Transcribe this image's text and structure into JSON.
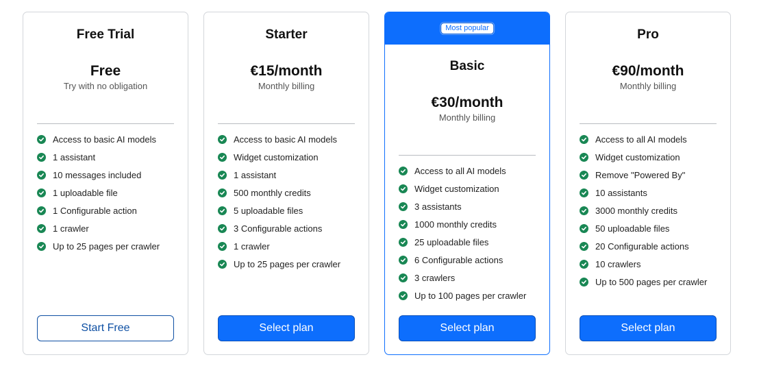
{
  "plans": [
    {
      "name": "Free Trial",
      "price": "Free",
      "billing": "Try with no obligation",
      "features": [
        "Access to basic AI models",
        "1 assistant",
        "10 messages included",
        "1 uploadable file",
        "1 Configurable action",
        "1 crawler",
        "Up to 25 pages per crawler"
      ],
      "button": "Start Free"
    },
    {
      "name": "Starter",
      "price": "€15/month",
      "billing": "Monthly billing",
      "features": [
        "Access to basic AI models",
        "Widget customization",
        "1 assistant",
        "500 monthly credits",
        "5 uploadable files",
        "3 Configurable actions",
        "1 crawler",
        "Up to 25 pages per crawler"
      ],
      "button": "Select plan"
    },
    {
      "badge": "Most popular",
      "name": "Basic",
      "price": "€30/month",
      "billing": "Monthly billing",
      "features": [
        "Access to all AI models",
        "Widget customization",
        "3 assistants",
        "1000 monthly credits",
        "25 uploadable files",
        "6 Configurable actions",
        "3 crawlers",
        "Up to 100 pages per crawler"
      ],
      "button": "Select plan"
    },
    {
      "name": "Pro",
      "price": "€90/month",
      "billing": "Monthly billing",
      "features": [
        "Access to all AI models",
        "Widget customization",
        "Remove \"Powered By\"",
        "10 assistants",
        "3000 monthly credits",
        "50 uploadable files",
        "20 Configurable actions",
        "10 crawlers",
        "Up to 500 pages per crawler"
      ],
      "button": "Select plan"
    }
  ],
  "colors": {
    "primary": "#0d6efd",
    "check": "#198754",
    "border": "#d3d6da"
  },
  "icons": {
    "feature": "check-circle-icon"
  }
}
